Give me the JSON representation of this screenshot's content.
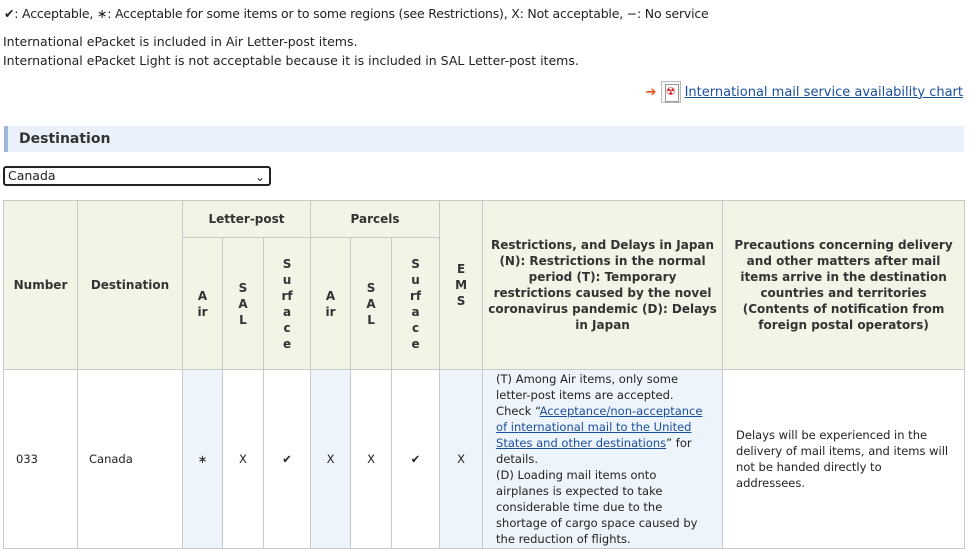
{
  "legend": "✔: Acceptable, ∗: Acceptable for some items or to some regions (see Restrictions), X: Not acceptable, −: No service",
  "notes": [
    "International ePacket is included in Air Letter-post items.",
    "International ePacket Light is not acceptable because it is included in SAL Letter-post items."
  ],
  "chart_link": "International mail service availability chart",
  "destination_heading": "Destination",
  "destination_select": "Canada",
  "table": {
    "headers": {
      "number": "Number",
      "destination": "Destination",
      "letter_post": "Letter-post",
      "parcels": "Parcels",
      "air": "Air",
      "sal": "SAL",
      "surface": "Surface",
      "ems": "EMS",
      "restrictions": "Restrictions, and Delays in Japan (N): Restrictions in the normal period (T): Temporary restrictions caused by the novel coronavirus pandemic (D): Delays in Japan",
      "precautions": "Precautions concerning delivery and other matters after mail items arrive in the destination countries and territories (Contents of notification from foreign postal operators)"
    },
    "row": {
      "number": "033",
      "destination": "Canada",
      "letter_air": "∗",
      "letter_sal": "X",
      "letter_surface": "✔",
      "parcel_air": "X",
      "parcel_sal": "X",
      "parcel_surface": "✔",
      "ems": "X",
      "restr_t_prefix": "(T) Among Air items, only some letter-post items are accepted. Check “",
      "restr_t_link": "Acceptance/non-acceptance of international mail to the United States and other destinations",
      "restr_t_suffix": "” for details.",
      "restr_d": "(D) Loading mail items onto airplanes is expected to take considerable time due to the shortage of cargo space caused by the reduction of flights.",
      "precautions": "Delays will be experienced in the delivery of mail items, and items will not be handed directly to addressees."
    }
  }
}
